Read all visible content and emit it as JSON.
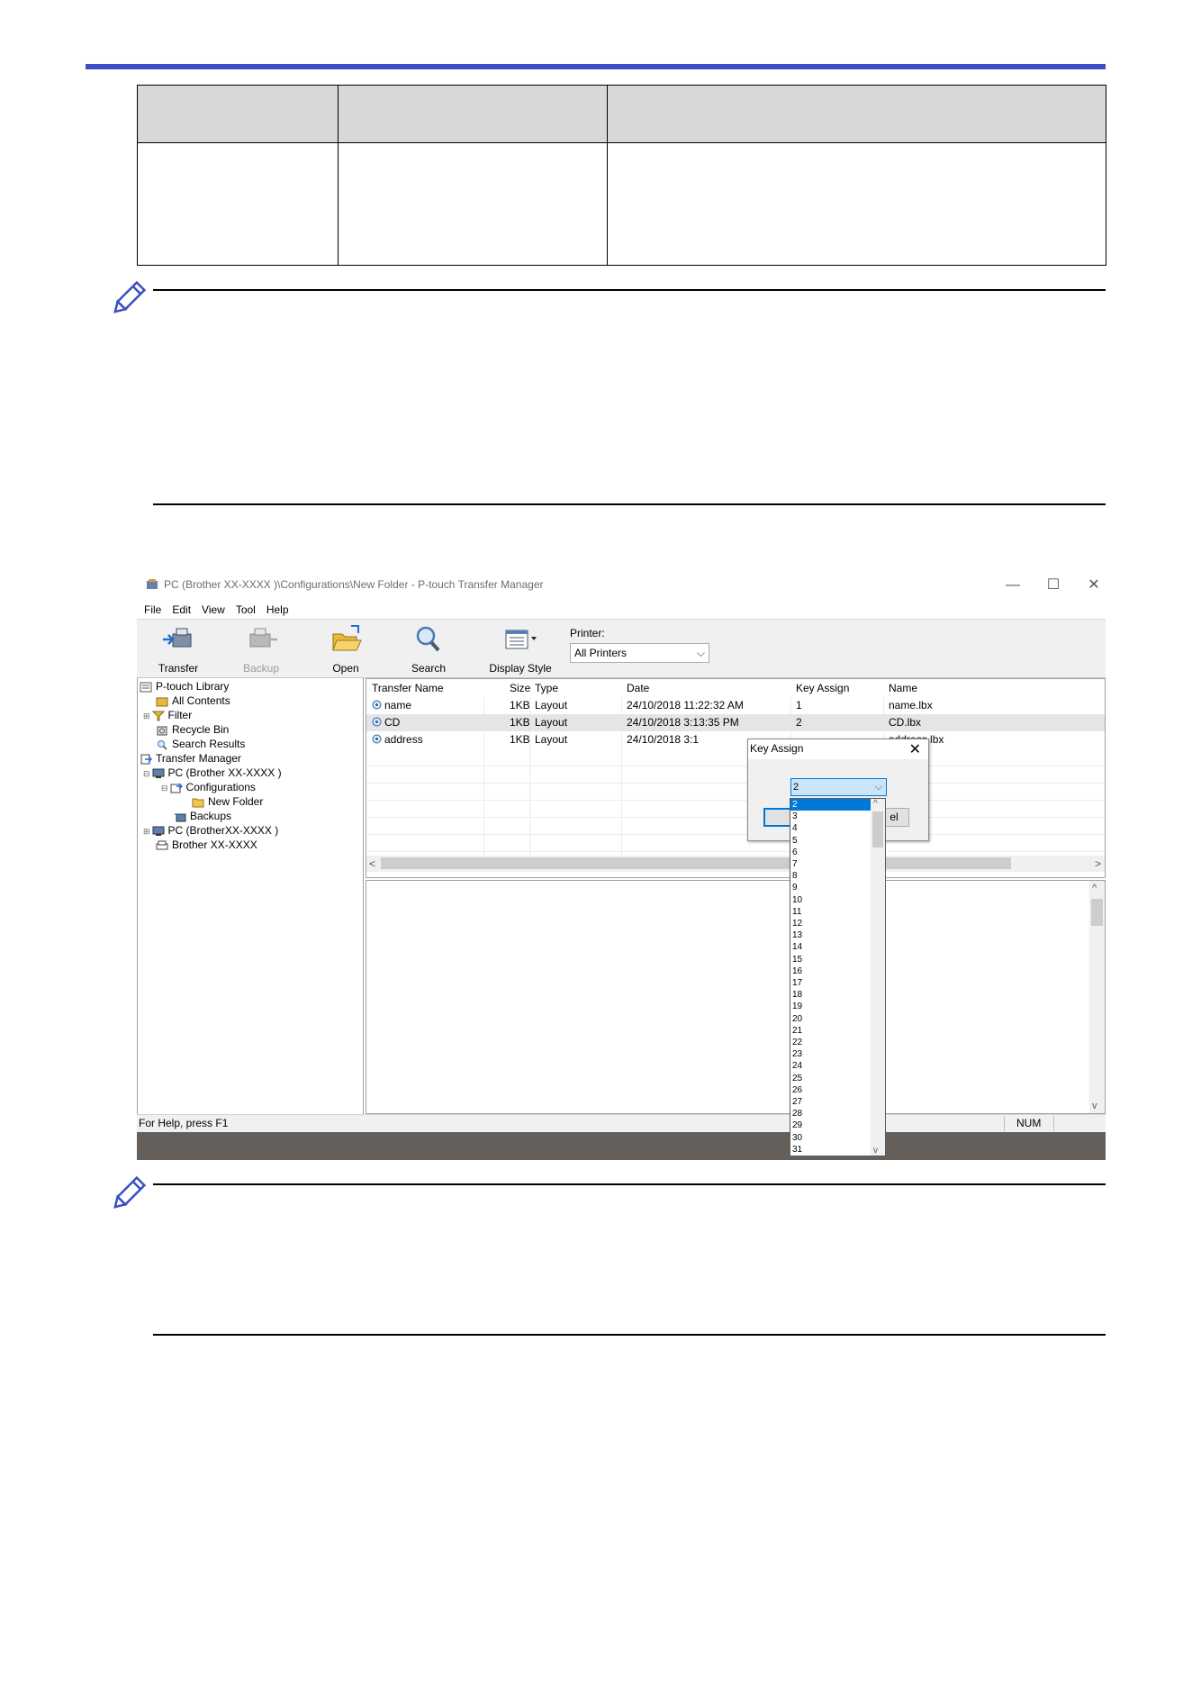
{
  "window": {
    "title": "PC (Brother XX-XXXX )\\Configurations\\New Folder - P-touch Transfer Manager",
    "controls": {
      "minimize": "—",
      "maximize": "☐",
      "close": "✕"
    }
  },
  "menu": [
    "File",
    "Edit",
    "View",
    "Tool",
    "Help"
  ],
  "toolbar": {
    "transfer": "Transfer",
    "backup": "Backup",
    "open": "Open",
    "search": "Search",
    "display_style": "Display Style",
    "printer_label": "Printer:",
    "printer_value": "All Printers"
  },
  "tree": {
    "library": "P-touch Library",
    "all_contents": "All Contents",
    "filter": "Filter",
    "recycle_bin": "Recycle Bin",
    "search_results": "Search Results",
    "transfer_manager": "Transfer Manager",
    "pc1": "PC (Brother XX-XXXX )",
    "configurations": "Configurations",
    "new_folder": "New Folder",
    "backups": "Backups",
    "pc2": "PC (BrotherXX-XXXX )",
    "brother": "Brother XX-XXXX"
  },
  "list": {
    "headers": [
      "Transfer Name",
      "Size",
      "Type",
      "Date",
      "Key Assign",
      "Name"
    ],
    "rows": [
      [
        "name",
        "1KB",
        "Layout",
        "24/10/2018 11:22:32 AM",
        "1",
        "name.lbx"
      ],
      [
        "CD",
        "1KB",
        "Layout",
        "24/10/2018 3:13:35 PM",
        "2",
        "CD.lbx"
      ],
      [
        "address",
        "1KB",
        "Layout",
        "24/10/2018 3:1",
        "",
        "address.lbx"
      ]
    ]
  },
  "status": {
    "help": "For Help, press F1",
    "num": "NUM"
  },
  "dialog": {
    "title": "Key Assign",
    "close": "✕",
    "combo_value": "2",
    "ok_label": "",
    "cancel_label": "el",
    "options": [
      "2",
      "3",
      "4",
      "5",
      "6",
      "7",
      "8",
      "9",
      "10",
      "11",
      "12",
      "13",
      "14",
      "15",
      "16",
      "17",
      "18",
      "19",
      "20",
      "21",
      "22",
      "23",
      "24",
      "25",
      "26",
      "27",
      "28",
      "29",
      "30",
      "31"
    ]
  },
  "colors": {
    "accent_rule": "#3b4fc4",
    "selection": "#0078d7",
    "desktop": "#655f5b"
  }
}
